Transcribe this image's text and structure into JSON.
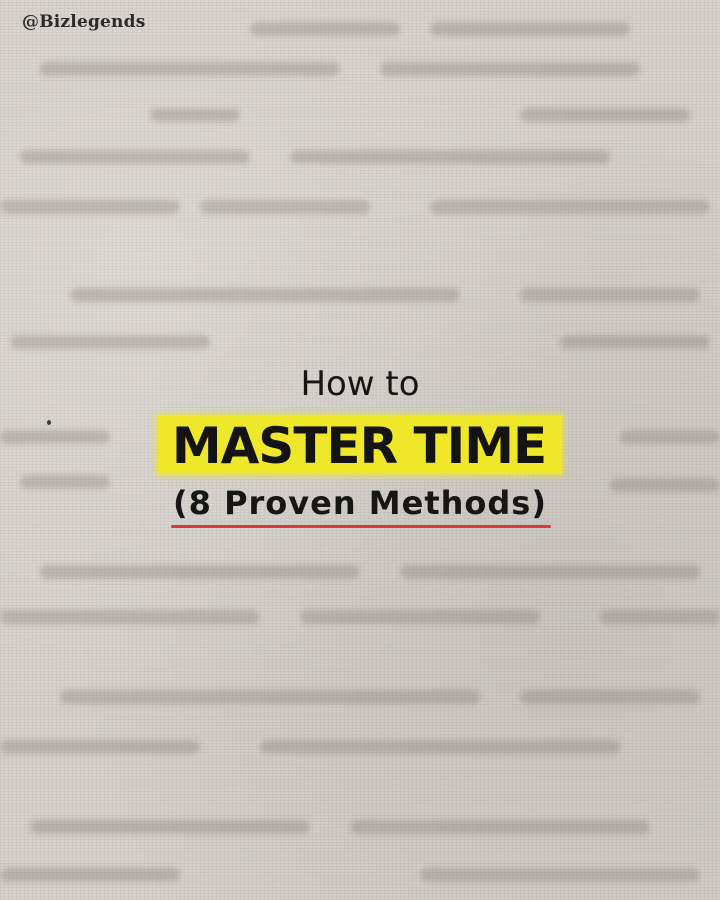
{
  "post": {
    "handle": "@Bizlegends",
    "pre_title": "How to",
    "headline": "MASTER TIME",
    "subtitle": "(8 Proven Methods)"
  },
  "colors": {
    "background": "#d3cec9",
    "highlight": "#efe82a",
    "underline": "#d93a3a",
    "text": "#151515"
  }
}
